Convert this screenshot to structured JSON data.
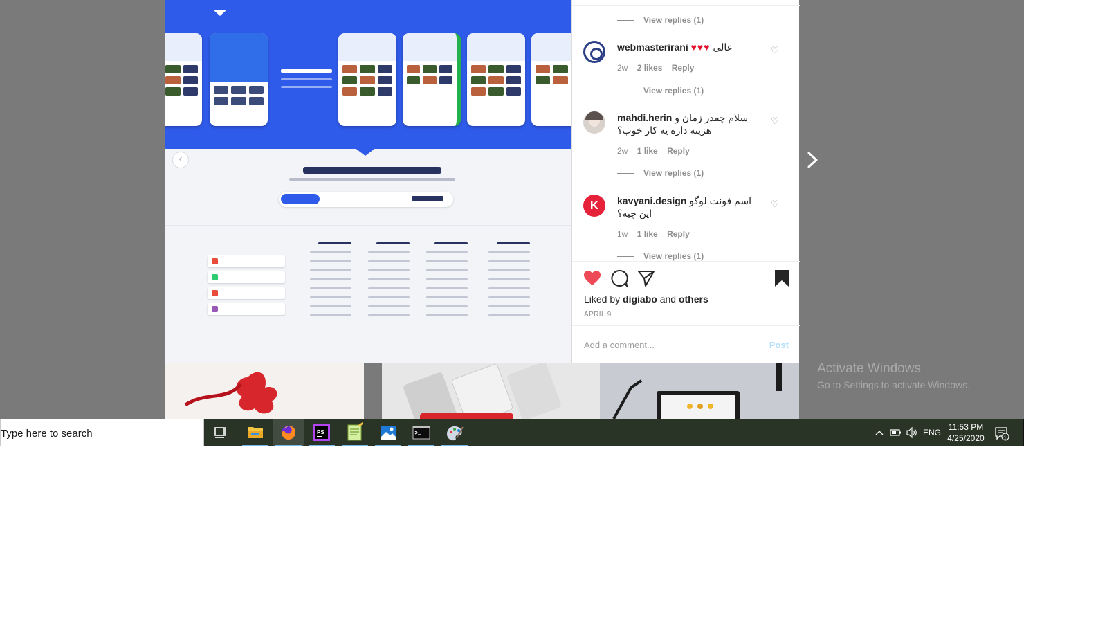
{
  "comments": [
    {
      "username": "webmasterirani",
      "text": "عالی",
      "hearts": "♥♥♥",
      "age": "2w",
      "likes": "2 likes",
      "reply": "Reply",
      "replies": "View replies (1)"
    },
    {
      "username": "mahdi.herin",
      "text": "سلام چقدر زمان و هزینه داره یه کار خوب؟",
      "age": "2w",
      "likes": "1 like",
      "reply": "Reply",
      "replies": "View replies (1)"
    },
    {
      "username": "kavyani.design",
      "avatar_letter": "K",
      "text": "اسم فونت لوگو این چیه؟",
      "age": "1w",
      "likes": "1 like",
      "reply": "Reply",
      "replies": "View replies (1)"
    }
  ],
  "top_replies": "View replies (1)",
  "liked_by": {
    "prefix": "Liked by",
    "user": "digiabo",
    "and": "and",
    "others": "others"
  },
  "post_date": "APRIL 9",
  "add_comment": {
    "placeholder": "Add a comment...",
    "post": "Post"
  },
  "watermark": {
    "line1": "Activate Windows",
    "line2": "Go to Settings to activate Windows."
  },
  "taskbar": {
    "search_placeholder": "Type here to search",
    "language": "ENG",
    "time": "11:53 PM",
    "date": "4/25/2020",
    "notification_count": "1"
  },
  "colors": {
    "banner_blue": "#2f5bea",
    "liked_heart": "#ed4956",
    "link_blue": "#b2dffc",
    "taskbar": "#2a3426"
  }
}
